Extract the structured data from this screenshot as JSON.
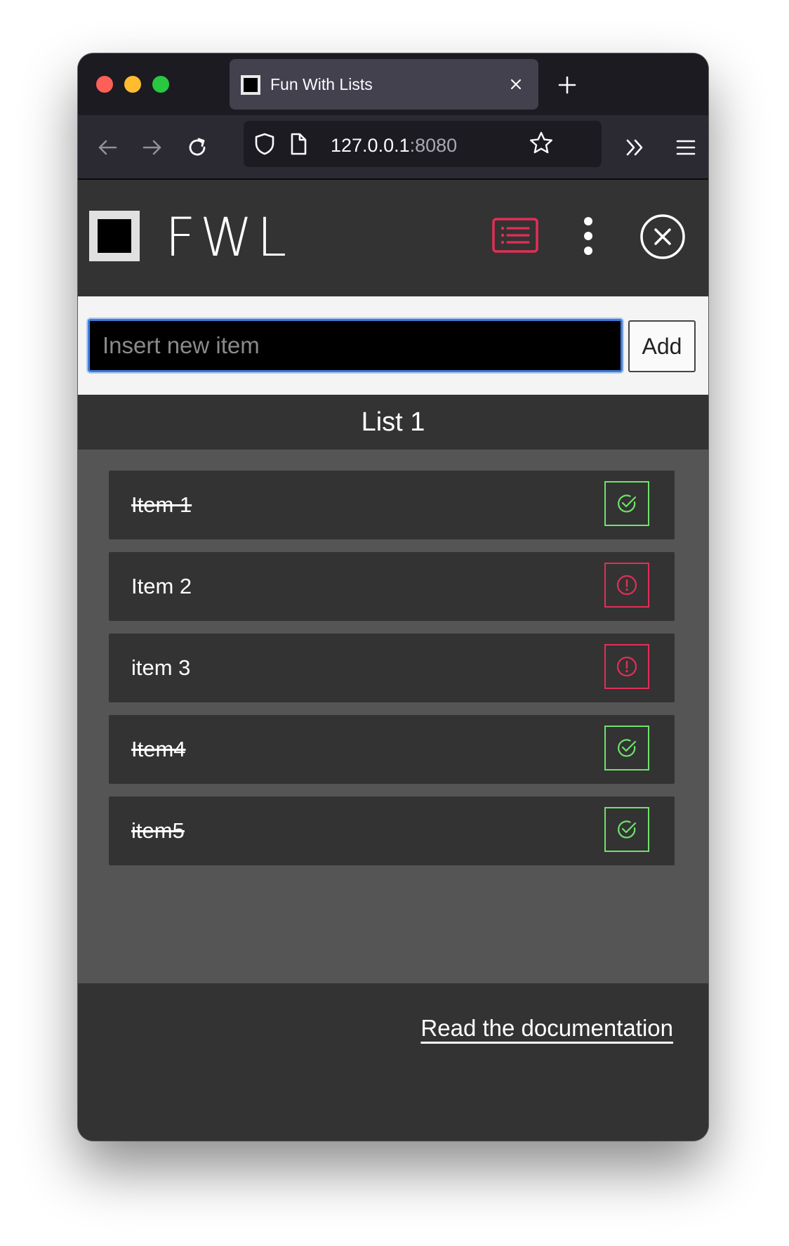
{
  "browser": {
    "tab_title": "Fun With Lists",
    "url_host": "127.0.0.1",
    "url_port": ":8080"
  },
  "app": {
    "brand": "FWL",
    "input_placeholder": "Insert new item",
    "add_label": "Add",
    "list_title": "List 1",
    "items": [
      {
        "text": "Item 1",
        "done": true
      },
      {
        "text": "Item 2",
        "done": false
      },
      {
        "text": "item 3",
        "done": false
      },
      {
        "text": "Item4",
        "done": true
      },
      {
        "text": "item5",
        "done": true
      }
    ],
    "footer_link": "Read the documentation"
  },
  "colors": {
    "done": "#6fe26a",
    "pending": "#e32e57",
    "header_bg": "#333333",
    "list_bg": "#555555"
  },
  "icons": [
    "list-icon",
    "kebab-menu-icon",
    "close-circle-icon",
    "check-circle-icon",
    "alert-circle-icon"
  ]
}
